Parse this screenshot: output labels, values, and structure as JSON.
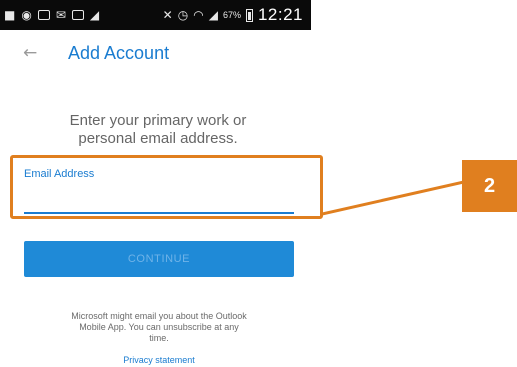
{
  "status_bar": {
    "battery_percent": "67%",
    "time": "12:21",
    "left_icons": [
      "app-icon",
      "messenger-icon",
      "sim-icon",
      "mail-icon",
      "photo-icon",
      "brush-icon"
    ],
    "right_icons": [
      "mute-icon",
      "alarm-icon",
      "wifi-icon",
      "signal-icon",
      "battery-icon"
    ]
  },
  "header": {
    "back_icon": "arrow-left-icon",
    "title": "Add Account"
  },
  "prompt": {
    "line1": "Enter your primary work or",
    "line2": "personal email address."
  },
  "email_field": {
    "label": "Email Address",
    "value": "",
    "placeholder": ""
  },
  "continue_button": {
    "label": "CONTINUE",
    "enabled": false
  },
  "disclaimer": {
    "line1": "Microsoft might email you about the Outlook",
    "line2": "Mobile App. You can unsubscribe at any",
    "line3": "time."
  },
  "privacy_link": "Privacy statement",
  "callout": {
    "number": "2",
    "color": "#e07f1f"
  },
  "colors": {
    "accent": "#1a7cd0",
    "button": "#1f8ad7",
    "status_bar": "#0a0a0a"
  }
}
